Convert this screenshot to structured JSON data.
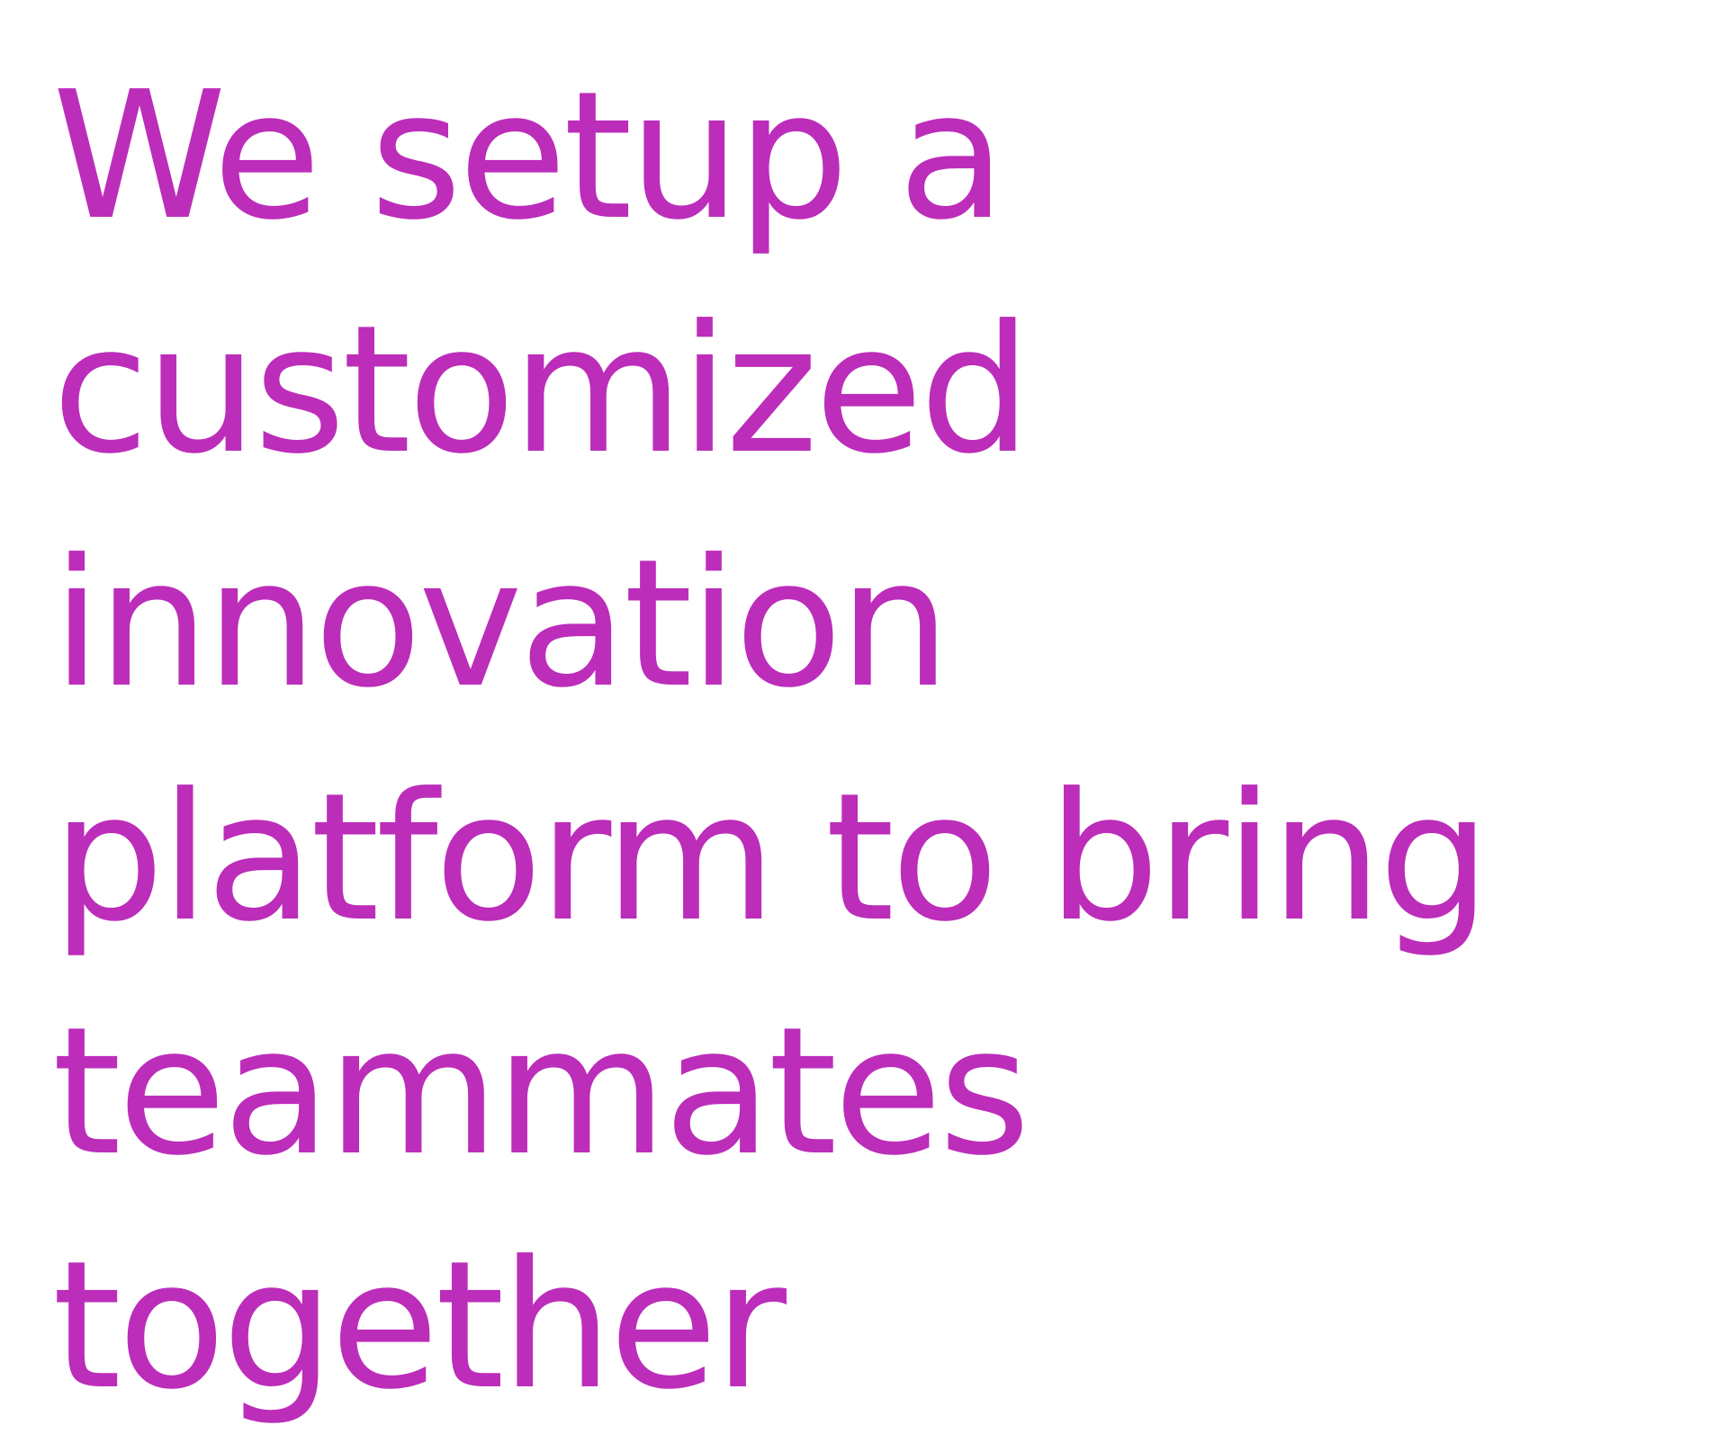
{
  "headline": {
    "lines": [
      "We setup a",
      "customized",
      "innovation",
      "platform to bring",
      "teammates",
      "together"
    ]
  },
  "colors": {
    "text": "#bc2dba",
    "background": "#ffffff"
  }
}
